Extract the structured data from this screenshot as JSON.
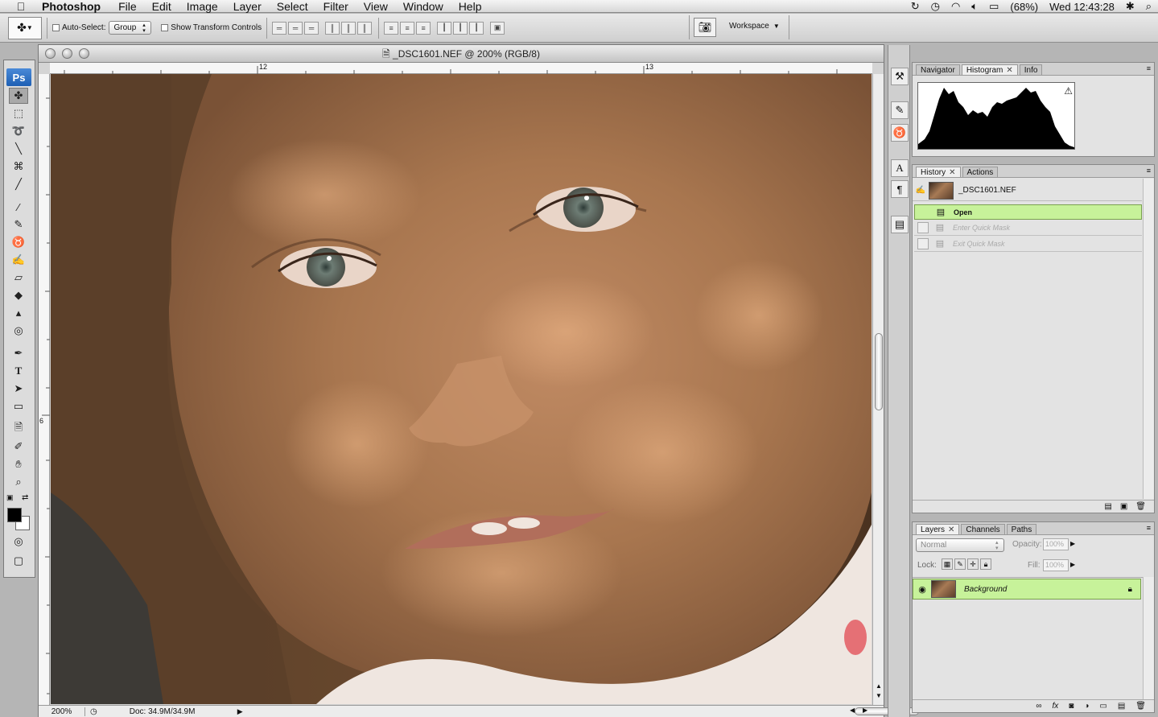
{
  "menubar": {
    "apple": "",
    "app_name": "Photoshop",
    "items": [
      "File",
      "Edit",
      "Image",
      "Layer",
      "Select",
      "Filter",
      "View",
      "Window",
      "Help"
    ],
    "battery": "(68%)",
    "clock": "Wed 12:43:28"
  },
  "options": {
    "auto_select_label": "Auto-Select:",
    "auto_select_value": "Group",
    "transform_label": "Show Transform Controls",
    "workspace_label": "Workspace"
  },
  "toolbox": {
    "logo": "Ps"
  },
  "document": {
    "title": "_DSC1601.NEF @ 200% (RGB/8)",
    "ruler_h_12": "12",
    "ruler_h_13": "13",
    "ruler_v_6": "6",
    "zoom": "200%",
    "doc_size": "Doc: 34.9M/34.9M"
  },
  "nav_panel": {
    "tabs": [
      "Navigator",
      "Histogram",
      "Info"
    ]
  },
  "history_panel": {
    "tabs": [
      "History",
      "Actions"
    ],
    "snapshot": "_DSC1601.NEF",
    "states": [
      "Open",
      "Enter Quick Mask",
      "Exit Quick Mask"
    ]
  },
  "layers_panel": {
    "tabs": [
      "Layers",
      "Channels",
      "Paths"
    ],
    "blend_mode": "Normal",
    "opacity_label": "Opacity:",
    "opacity_value": "100%",
    "lock_label": "Lock:",
    "fill_label": "Fill:",
    "fill_value": "100%",
    "layer_name": "Background"
  },
  "colors": {
    "highlight_green": "#c7f29a",
    "ps_blue": "#1e5fb4"
  }
}
